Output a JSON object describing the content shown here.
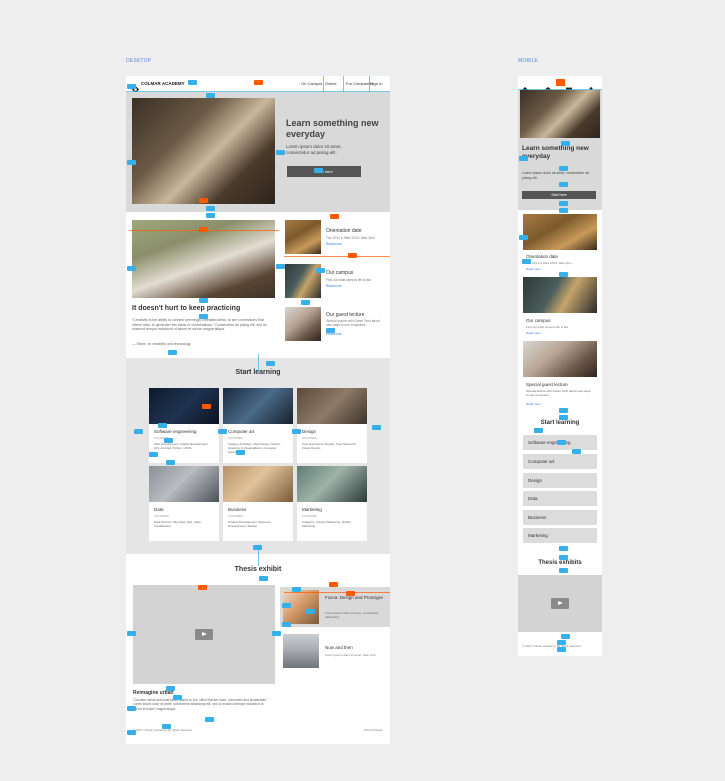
{
  "labels": {
    "desktop": "DESKTOP",
    "mobile": "MOBILE"
  },
  "desktop": {
    "logo": "COLMAR ACADEMY",
    "nav": [
      "On Campus",
      "Online",
      "For Companies",
      "Sign In"
    ],
    "hero": {
      "title": "Learn something new everyday",
      "subtitle": "Lorem ipsum dolor sit amet, consectetur ad pising elit.",
      "button": "Start here"
    },
    "feature": {
      "title": "It doesn't hurt to keep practicing",
      "body": "\"Creativity is the ability to connect seemingly unrelated ideas; to see connections that others miss; to generate new ideas or combinations.\" Consectetur ad pising elit, sed do eiusmod tempor incididunt ut labore et dolore magna aliqua.",
      "author": "— Steve, on creativity and technology"
    },
    "side_items": [
      {
        "title": "Orientation date",
        "meta": "Tue 10/11 & Wed 10/12: 8am-3pm",
        "link": "Read more"
      },
      {
        "title": "Our campus",
        "meta": "Find out what campus life is like",
        "link": "Read more"
      },
      {
        "title": "Our guest lecture",
        "meta": "Special lecture with Green Tech about new ways to use computers",
        "link": "Read more"
      }
    ],
    "learning": {
      "title": "Start learning",
      "courses": [
        {
          "title": "Software engineering",
          "count": "COURSES",
          "desc": "Web Development, Mobile Development, iOS, Android, Python, HTML"
        },
        {
          "title": "Computer art",
          "count": "COURSES",
          "desc": "Imaging & Design, Web Design, Motion Graphics & Visual Effects, Computer Animation"
        },
        {
          "title": "Design",
          "count": "COURSES",
          "desc": "User Experience Design, User Research, Visual Design"
        },
        {
          "title": "Data",
          "count": "COURSES",
          "desc": "Data Science, Big Data, SQL, Data Visualization"
        },
        {
          "title": "Business",
          "count": "COURSES",
          "desc": "Product Development, Business Development, Startup"
        },
        {
          "title": "Marketing",
          "count": "COURSES",
          "desc": "Analytics, Content Marketing, Mobile Marketing"
        }
      ]
    },
    "thesis": {
      "title": "Thesis exhibit",
      "video_caption": "Reimagine urban",
      "video_desc": "\"Combine ideas and build better places to live: cities that are open, connected and sustainable.\" Lorem ipsum dolor sit amet, consectetur adipisicing elit, sed do eiusmod tempor incididunt ut labore et dolore magna aliqua.",
      "items": [
        {
          "title": "Fixma: Design and Prototype",
          "meta": "Lorem ipsum dolor sit amet, consectetur adipisicing"
        },
        {
          "title": "Now and then",
          "meta": "Lorem ipsum dolor sit amet, New York"
        }
      ]
    },
    "footer": {
      "copy": "© 2017 Colmar Academy. All rights reserved.",
      "links": "Terms  Privacy"
    }
  },
  "mobile": {
    "hero": {
      "title": "Learn something new everyday",
      "subtitle": "Lorem ipsum dolor sit amet, consectetur ad pising elit.",
      "button": "Start here"
    },
    "items": [
      {
        "title": "Orientation date",
        "meta": "Tue 10/11 & Wed 10/12: 8am-3pm",
        "link": "Read more"
      },
      {
        "title": "Our campus",
        "meta": "Find out what campus life is like",
        "link": "Read more"
      },
      {
        "title": "Special guest lecture",
        "meta": "Special lecture with Green Tech about new ways to use computers",
        "link": "Read more"
      }
    ],
    "learning_title": "Start learning",
    "categories": [
      "Software engineering",
      "Computer art",
      "Design",
      "Data",
      "Business",
      "Marketing"
    ],
    "thesis_title": "Thesis exhibits",
    "footer": "© 2017 Colmar Academy. All rights reserved."
  },
  "colors": {
    "spacing_tag": "#36b0ea",
    "measure_tag": "#ff5a00",
    "section_gray": "#e5e5e5",
    "button": "#555555"
  }
}
